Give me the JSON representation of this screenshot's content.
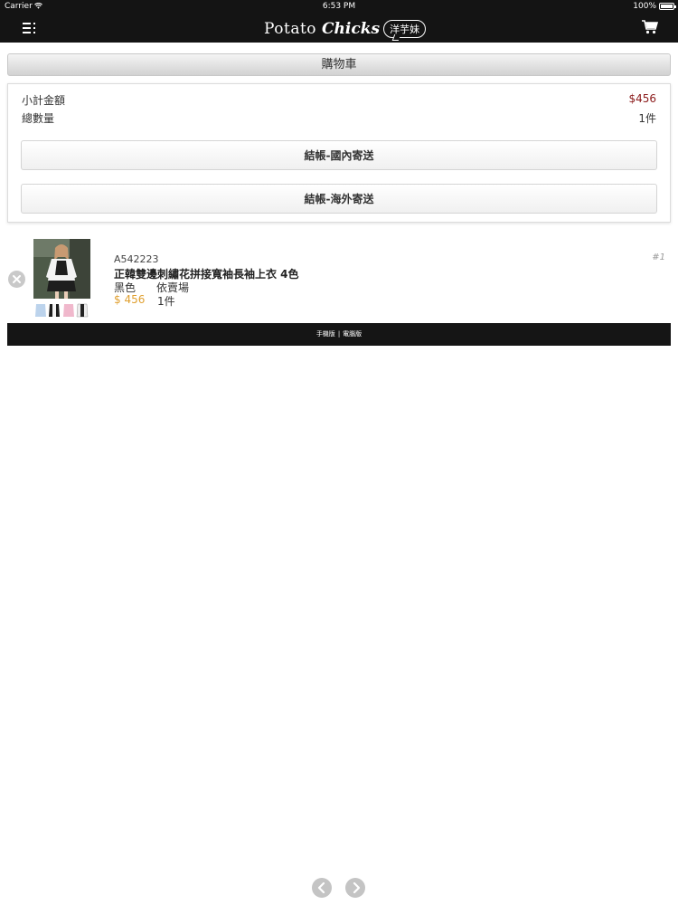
{
  "status_bar": {
    "carrier": "Carrier",
    "time": "6:53 PM",
    "battery": "100%"
  },
  "nav": {
    "logo_potato": "Potato",
    "logo_chicks": "Chicks",
    "logo_badge": "洋芋妹",
    "menu_icon": "hamburger-menu-icon",
    "cart_icon": "shopping-cart-icon"
  },
  "cart": {
    "title": "購物車",
    "subtotal_label": "小計金額",
    "subtotal_value": "$456",
    "quantity_label": "總數量",
    "quantity_value": "1件",
    "checkout_domestic": "結帳-國內寄送",
    "checkout_overseas": "結帳-海外寄送"
  },
  "items": [
    {
      "index": "#1",
      "code": "A542223",
      "name": "正韓雙邊刺繡花拼接寬袖長袖上衣 4色",
      "color": "黑色",
      "size": "依賣場",
      "price": "$ 456",
      "qty": "1件"
    }
  ],
  "footer": {
    "mobile_label": "手機版",
    "separator": "|",
    "desktop_label": "電腦版"
  },
  "colors": {
    "nav_bg": "#141414",
    "subtotal_value": "#8b1a1a",
    "price": "#e0a030"
  }
}
